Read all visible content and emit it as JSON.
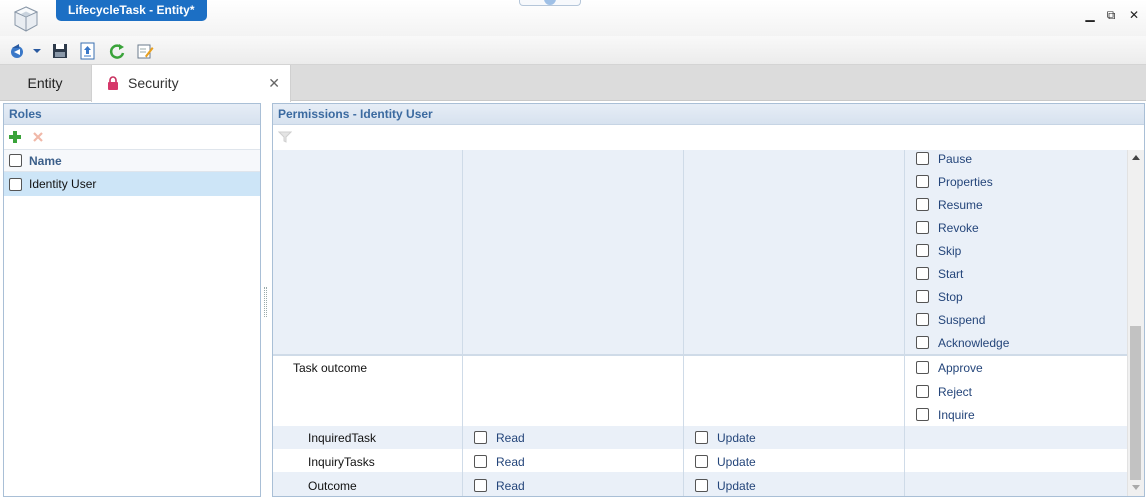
{
  "window": {
    "title": "LifecycleTask - Entity*"
  },
  "window_controls": {
    "minimize": "▁",
    "restore": "⧉",
    "close": "✕"
  },
  "toolbar": {
    "icons": [
      "navigate-icon",
      "dropdown-icon",
      "save-icon",
      "publish-icon",
      "refresh-icon",
      "edit-icon"
    ]
  },
  "tabs": [
    {
      "label": "Entity"
    },
    {
      "label": "Security",
      "close": "✕"
    }
  ],
  "roles_panel": {
    "title": "Roles",
    "column_name": "Name",
    "items": [
      {
        "label": "Identity User",
        "selected": true
      }
    ]
  },
  "permissions_panel": {
    "title": "Permissions - Identity User",
    "task_actions": [
      "Pause",
      "Properties",
      "Resume",
      "Revoke",
      "Skip",
      "Start",
      "Stop",
      "Suspend",
      "Acknowledge"
    ],
    "task_outcome": {
      "label": "Task outcome",
      "actions": [
        "Approve",
        "Reject",
        "Inquire"
      ]
    },
    "rows": [
      {
        "label": "InquiredTask",
        "read": "Read",
        "update": "Update"
      },
      {
        "label": "InquiryTasks",
        "read": "Read",
        "update": "Update"
      },
      {
        "label": "Outcome",
        "read": "Read",
        "update": "Update"
      }
    ]
  }
}
